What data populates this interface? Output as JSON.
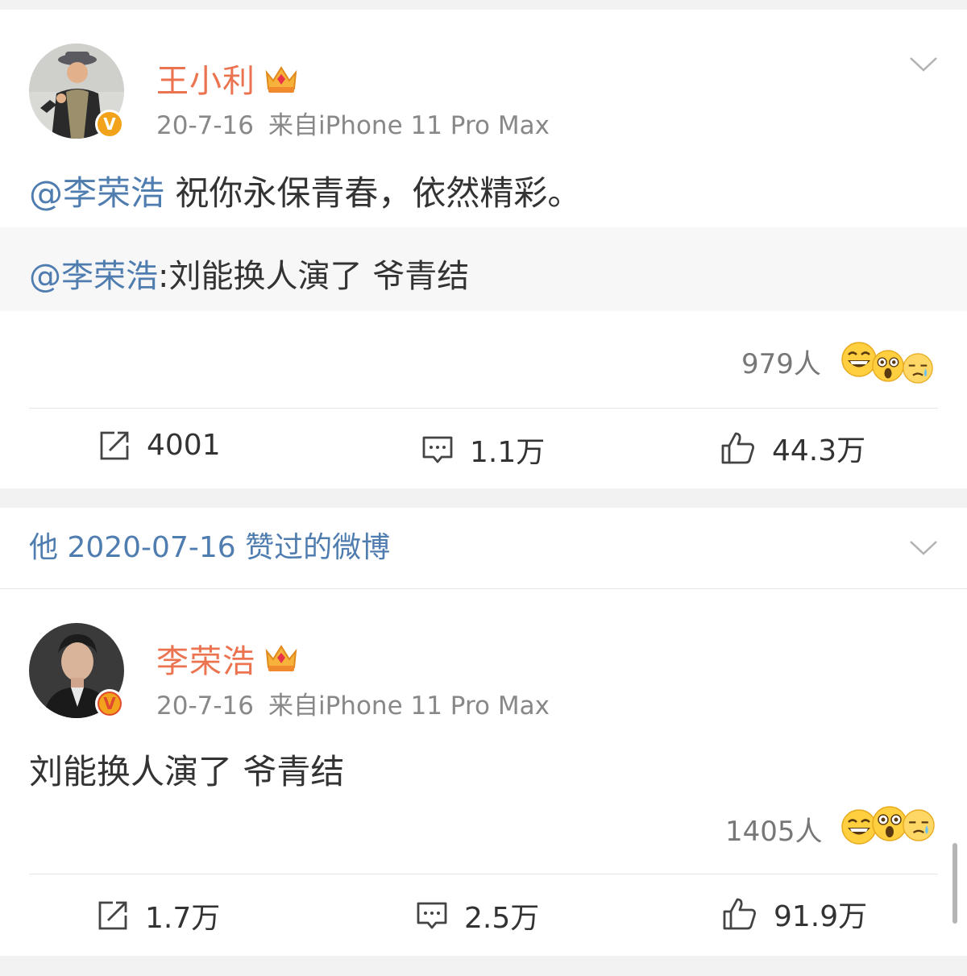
{
  "colors": {
    "name": "#eb7350",
    "mention": "#507daf",
    "verified": "#f2a31b"
  },
  "posts": [
    {
      "author": "王小利",
      "date": "20-7-16",
      "source": "来自iPhone 11 Pro Max",
      "badge": "V",
      "text_mention": "@李荣浩",
      "text": " 祝你永保青春，依然精彩。",
      "repost": {
        "mention": "@李荣浩",
        "text": ":刘能换人演了 爷青结"
      },
      "reactions": "979人",
      "emojis": [
        "grin-emoji",
        "shocked-emoji",
        "crying-emoji"
      ],
      "actions": {
        "repost": "4001",
        "comment": "1.1万",
        "like": "44.3万"
      }
    },
    {
      "liked_header": "他 2020-07-16 赞过的微博",
      "author": "李荣浩",
      "date": "20-7-16",
      "source": "来自iPhone 11 Pro Max",
      "badge": "V",
      "text": "刘能换人演了 爷青结",
      "reactions": "1405人",
      "emojis": [
        "grin-emoji",
        "shocked-emoji",
        "crying-emoji"
      ],
      "actions": {
        "repost": "1.7万",
        "comment": "2.5万",
        "like": "91.9万"
      }
    }
  ]
}
